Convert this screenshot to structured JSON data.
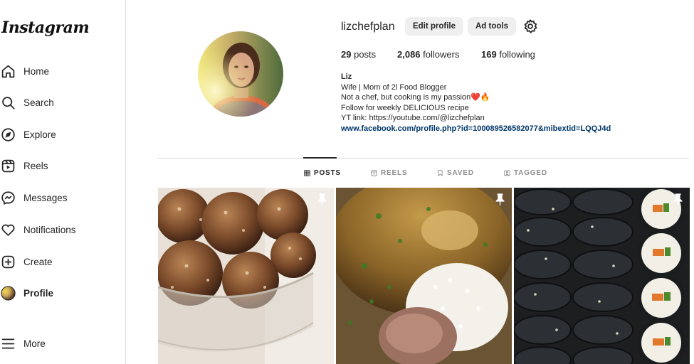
{
  "sidebar": {
    "logo": "Instagram",
    "items": [
      {
        "label": "Home",
        "icon": "home-icon"
      },
      {
        "label": "Search",
        "icon": "search-icon"
      },
      {
        "label": "Explore",
        "icon": "compass-icon"
      },
      {
        "label": "Reels",
        "icon": "reels-icon"
      },
      {
        "label": "Messages",
        "icon": "messenger-icon"
      },
      {
        "label": "Notifications",
        "icon": "heart-icon"
      },
      {
        "label": "Create",
        "icon": "plus-square-icon"
      },
      {
        "label": "Profile",
        "icon": "avatar"
      },
      {
        "label": "More",
        "icon": "hamburger-icon"
      }
    ]
  },
  "profile": {
    "username": "lizchefplan",
    "edit_button": "Edit profile",
    "ad_button": "Ad tools",
    "stats": {
      "posts_count": "29",
      "posts_label": "posts",
      "followers_count": "2,086",
      "followers_label": "followers",
      "following_count": "169",
      "following_label": "following"
    },
    "bio": {
      "name": "Liz",
      "line1": "Wife | Mom of 2l Food Blogger",
      "line2": "Not a chef, but cooking is my passion",
      "line2_emoji": "❤️🔥",
      "line3": "Follow for weekly DELICIOUS recipe",
      "line4": "YT link: https://youtube.com/@lizchefplan",
      "link": "www.facebook.com/profile.php?id=100089526582077&mibextid=LQQJ4d"
    }
  },
  "tabs": [
    {
      "label": "POSTS",
      "icon": "grid-icon",
      "active": true
    },
    {
      "label": "REELS",
      "icon": "reels-icon",
      "active": false
    },
    {
      "label": "SAVED",
      "icon": "bookmark-icon",
      "active": false
    },
    {
      "label": "TAGGED",
      "icon": "tagged-icon",
      "active": false
    }
  ],
  "posts": [
    {
      "subject": "energy balls in glass bowl",
      "pinned": true
    },
    {
      "subject": "salisbury steak with gravy and rice",
      "pinned": true
    },
    {
      "subject": "kimbap rolls",
      "pinned": true
    }
  ],
  "colors": {
    "text": "#262626",
    "muted": "#8e8e8e",
    "link": "#00376b",
    "button_bg": "#efefef",
    "border": "#dbdbdb"
  }
}
